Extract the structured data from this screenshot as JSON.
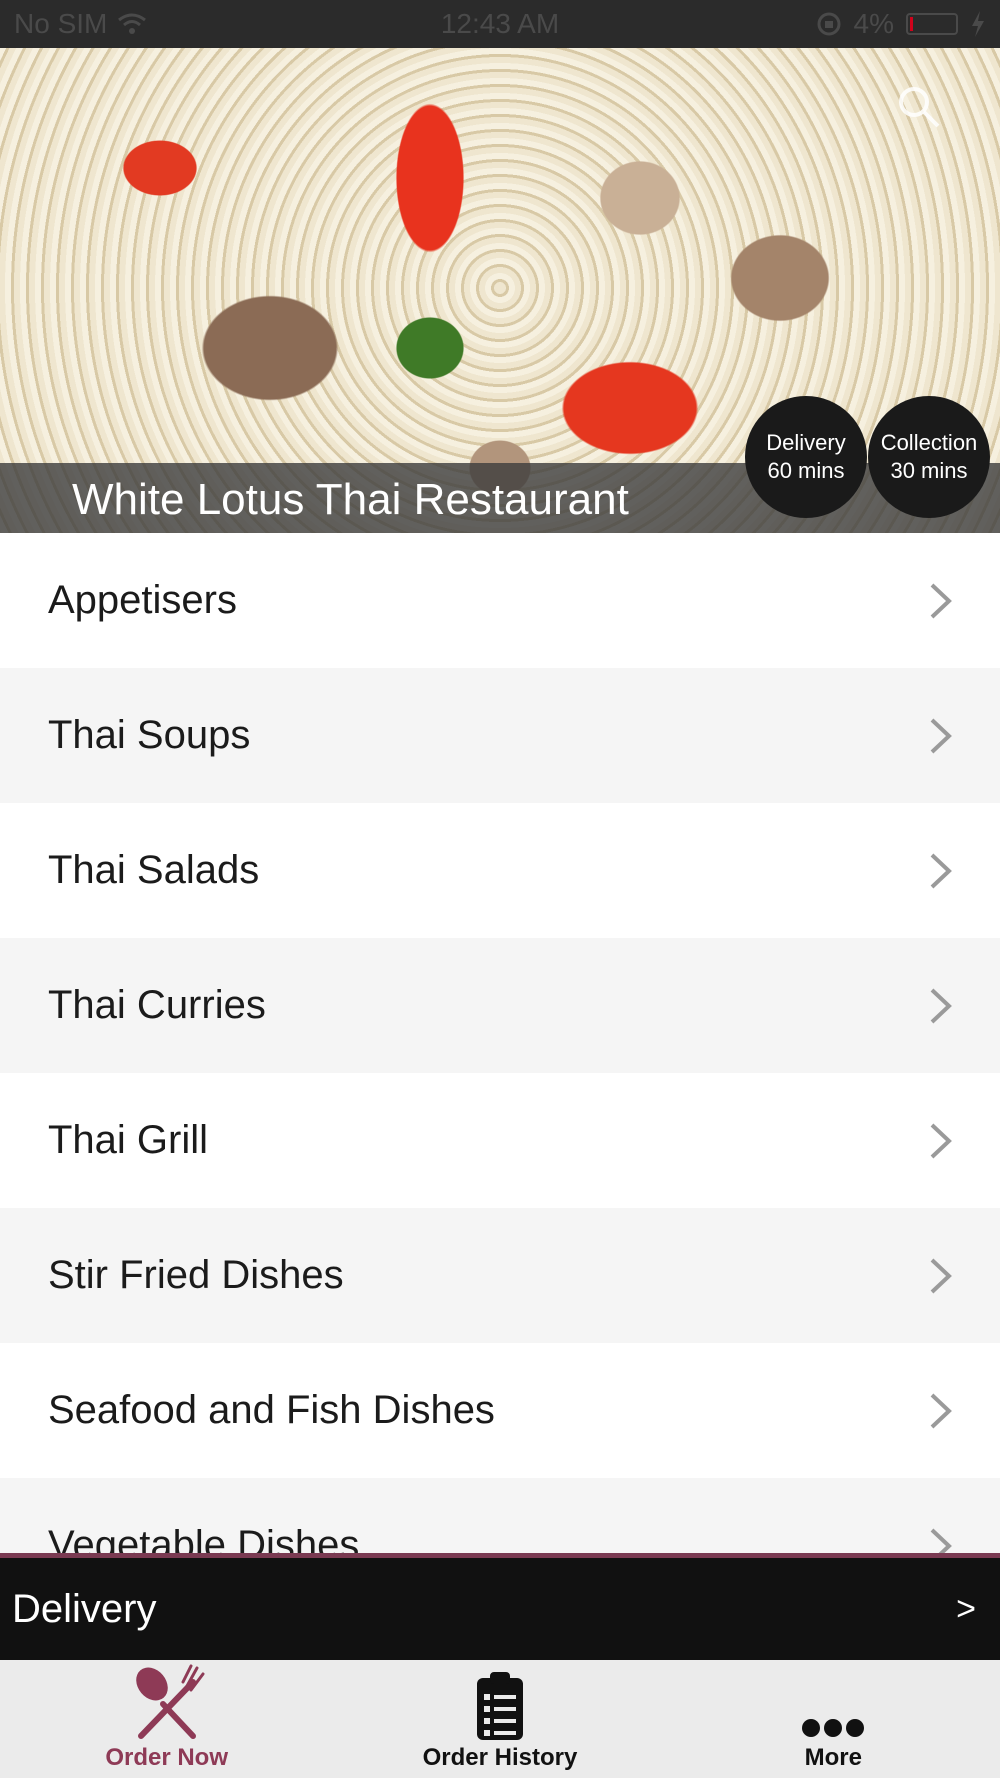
{
  "status_bar": {
    "carrier": "No SIM",
    "time": "12:43 AM",
    "battery": "4%"
  },
  "hero": {
    "restaurant_name": "White Lotus Thai Restaurant",
    "delivery_badge": {
      "label": "Delivery",
      "time": "60 mins"
    },
    "collection_badge": {
      "label": "Collection",
      "time": "30 mins"
    }
  },
  "menu": {
    "items": [
      {
        "label": "Appetisers"
      },
      {
        "label": "Thai Soups"
      },
      {
        "label": "Thai Salads"
      },
      {
        "label": "Thai Curries"
      },
      {
        "label": "Thai Grill"
      },
      {
        "label": "Stir Fried Dishes"
      },
      {
        "label": "Seafood and Fish Dishes"
      },
      {
        "label": "Vegetable Dishes"
      }
    ]
  },
  "delivery_bar": {
    "label": "Delivery",
    "arrow": ">"
  },
  "tabs": [
    {
      "label": "Order Now"
    },
    {
      "label": "Order History"
    },
    {
      "label": "More"
    }
  ],
  "colors": {
    "accent": "#8e3a56",
    "bar": "#111111"
  }
}
